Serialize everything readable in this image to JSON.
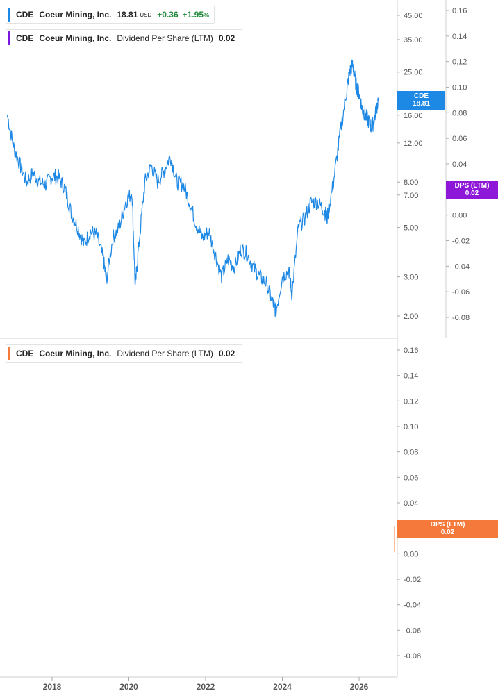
{
  "legends": {
    "price": {
      "symbol": "CDE",
      "name": "Coeur Mining, Inc.",
      "value": "18.81",
      "currency": "USD",
      "change": "+0.36",
      "change_pct": "+1.95",
      "pct_sign": "%",
      "color": "#1e88e5"
    },
    "dps_top": {
      "symbol": "CDE",
      "name": "Coeur Mining, Inc.",
      "metric": "Dividend Per Share (LTM)",
      "value": "0.02",
      "color": "#7b16e0"
    },
    "dps_bottom": {
      "symbol": "CDE",
      "name": "Coeur Mining, Inc.",
      "metric": "Dividend Per Share (LTM)",
      "value": "0.02",
      "color": "#f5793b"
    }
  },
  "tags": {
    "price": {
      "line1": "CDE",
      "line2": "18.81",
      "color": "#1e88e5"
    },
    "dps_top": {
      "line1": "DPS (LTM)",
      "line2": "0.02",
      "color": "#8e18d8"
    },
    "dps_bottom": {
      "line1": "DPS (LTM)",
      "line2": "0.02",
      "color": "#f5793b"
    }
  },
  "chart_data": [
    {
      "type": "line",
      "scale": "log",
      "series": [
        {
          "name": "CDE",
          "x": [
            "2016-11",
            "2017-01",
            "2017-03",
            "2017-05",
            "2017-07",
            "2017-09",
            "2017-11",
            "2018-01",
            "2018-03",
            "2018-05",
            "2018-07",
            "2018-09",
            "2018-11",
            "2019-01",
            "2019-03",
            "2019-05",
            "2019-06",
            "2019-08",
            "2019-10",
            "2019-12",
            "2020-02",
            "2020-03",
            "2020-04",
            "2020-06",
            "2020-08",
            "2020-10",
            "2020-12",
            "2021-02",
            "2021-04",
            "2021-06",
            "2021-08",
            "2021-10",
            "2021-12",
            "2022-02",
            "2022-04",
            "2022-06",
            "2022-08",
            "2022-10",
            "2022-12",
            "2023-02",
            "2023-04",
            "2023-06",
            "2023-08",
            "2023-10",
            "2023-11",
            "2024-01",
            "2024-03",
            "2024-04",
            "2024-06",
            "2024-08",
            "2024-10",
            "2024-12",
            "2025-02",
            "2025-03",
            "2025-05",
            "2025-07",
            "2025-09",
            "2025-10",
            "2025-11",
            "2025-12",
            "2026-01",
            "2026-02",
            "2026-03",
            "2026-04",
            "2026-05",
            "2026-06",
            "2026-07"
          ],
          "values": [
            16.0,
            11.5,
            9.5,
            8.0,
            8.8,
            8.0,
            7.8,
            8.5,
            8.4,
            7.5,
            5.8,
            5.0,
            4.2,
            4.8,
            4.6,
            3.6,
            2.9,
            4.5,
            5.0,
            6.5,
            7.2,
            2.7,
            4.0,
            8.0,
            9.5,
            8.0,
            9.0,
            10.5,
            8.0,
            7.8,
            6.5,
            5.2,
            4.5,
            4.8,
            3.8,
            3.0,
            3.6,
            3.3,
            4.0,
            3.8,
            3.3,
            3.0,
            2.8,
            2.3,
            2.1,
            3.0,
            3.2,
            2.5,
            5.0,
            5.5,
            6.5,
            6.5,
            6.0,
            5.5,
            8.0,
            13.0,
            20.0,
            25.0,
            27.0,
            22.0,
            20.0,
            17.0,
            16.0,
            15.0,
            14.0,
            16.0,
            18.81
          ],
          "color": "#1e88e5"
        }
      ],
      "y_ticks": [
        "45.00",
        "35.00",
        "25.00",
        "16.00",
        "12.00",
        "8.00",
        "7.00",
        "5.00",
        "3.00",
        "2.00"
      ],
      "dps_axis_ticks": [
        "0.16",
        "0.14",
        "0.12",
        "0.10",
        "0.08",
        "0.06",
        "0.04",
        "0.02",
        "0.00",
        "-0.02",
        "-0.04",
        "-0.06",
        "-0.08"
      ]
    },
    {
      "type": "line",
      "series": [
        {
          "name": "Dividend Per Share (LTM)",
          "x": [
            "2026-06"
          ],
          "values": [
            0.02
          ],
          "color": "#f5793b"
        }
      ],
      "y_ticks": [
        "0.16",
        "0.14",
        "0.12",
        "0.10",
        "0.08",
        "0.06",
        "0.04",
        "0.02",
        "0.00",
        "-0.02",
        "-0.04",
        "-0.06",
        "-0.08"
      ],
      "x_ticks": [
        "2018",
        "2020",
        "2022",
        "2024",
        "2026"
      ],
      "ylim": [
        -0.08,
        0.16
      ]
    }
  ]
}
